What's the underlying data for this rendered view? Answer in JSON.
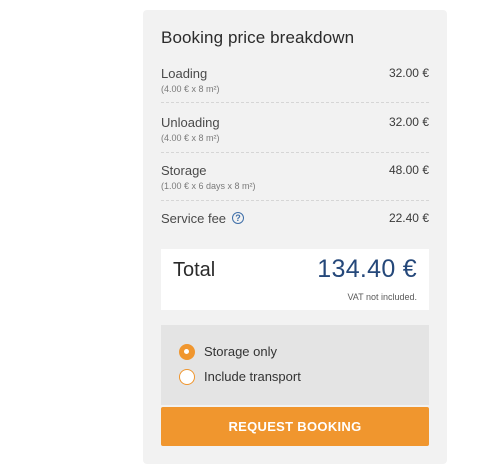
{
  "breakdown": {
    "title": "Booking price breakdown",
    "items": [
      {
        "label": "Loading",
        "detail": "(4.00 € x 8 m²)",
        "amount": "32.00 €"
      },
      {
        "label": "Unloading",
        "detail": "(4.00 € x 8 m²)",
        "amount": "32.00 €"
      },
      {
        "label": "Storage",
        "detail": "(1.00 € x 6 days x 8 m²)",
        "amount": "48.00 €"
      },
      {
        "label": "Service fee",
        "amount": "22.40 €",
        "icon": "help-circle-icon"
      }
    ]
  },
  "total": {
    "label": "Total",
    "amount": "134.40 €",
    "note": "VAT not included."
  },
  "options": [
    {
      "label": "Storage only",
      "selected": true
    },
    {
      "label": "Include transport",
      "selected": false
    }
  ],
  "actions": {
    "request_booking_label": "REQUEST BOOKING"
  },
  "colors": {
    "accent": "#f0962e",
    "total_amount": "#25487a",
    "help_icon": "#3f6fa8"
  }
}
